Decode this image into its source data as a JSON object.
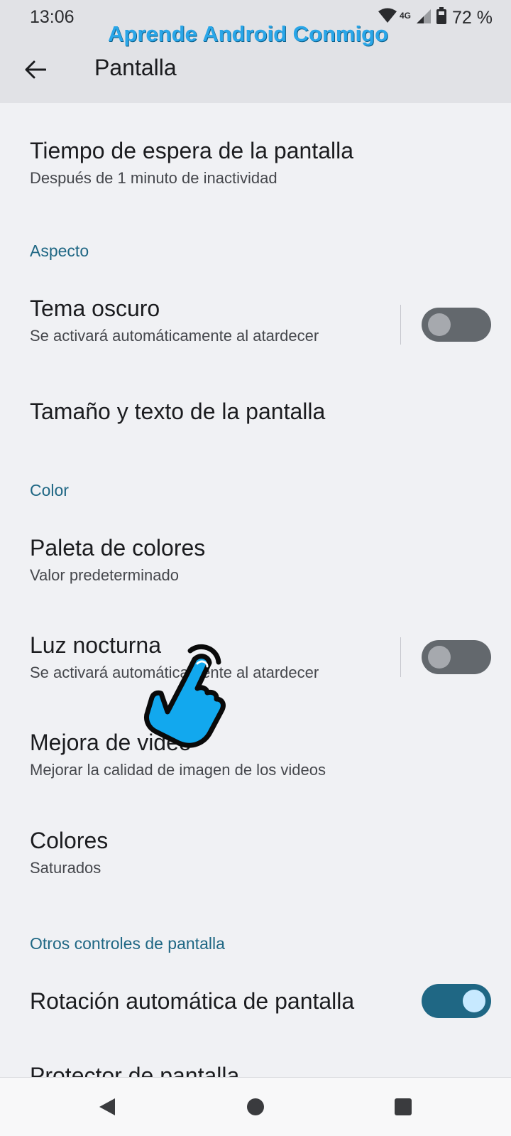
{
  "status": {
    "time": "13:06",
    "network": "4G",
    "battery": "72 %"
  },
  "watermark": "Aprende Android Conmigo",
  "header": {
    "title": "Pantalla"
  },
  "items": {
    "timeout": {
      "title": "Tiempo de espera de la pantalla",
      "subtitle": "Después de 1 minuto de inactividad"
    },
    "dark_theme": {
      "title": "Tema oscuro",
      "subtitle": "Se activará automáticamente al atardecer",
      "enabled": false
    },
    "display_size": {
      "title": "Tamaño y texto de la pantalla"
    },
    "palette": {
      "title": "Paleta de colores",
      "subtitle": "Valor predeterminado"
    },
    "night_light": {
      "title": "Luz nocturna",
      "subtitle": "Se activará automáticamente al atardecer",
      "enabled": false
    },
    "video_enhance": {
      "title": "Mejora de video",
      "subtitle": "Mejorar la calidad de imagen de los videos"
    },
    "colors": {
      "title": "Colores",
      "subtitle": "Saturados"
    },
    "auto_rotate": {
      "title": "Rotación automática de pantalla",
      "enabled": true
    },
    "screensaver": {
      "title": "Protector de pantalla"
    }
  },
  "sections": {
    "appearance": "Aspecto",
    "color": "Color",
    "other": "Otros controles de pantalla"
  },
  "colors": {
    "accent": "#1f6784",
    "toggle_off": "#63686d",
    "toggle_on": "#1f6784",
    "watermark": "#2aa6e8",
    "hand_fill": "#12a8ee"
  },
  "icons": {
    "back": "back-arrow-icon",
    "wifi": "wifi-icon",
    "signal": "signal-icon",
    "battery": "battery-icon",
    "pointer": "pointing-hand-icon",
    "nav_back": "nav-back-icon",
    "nav_home": "nav-home-icon",
    "nav_recents": "nav-recents-icon"
  }
}
